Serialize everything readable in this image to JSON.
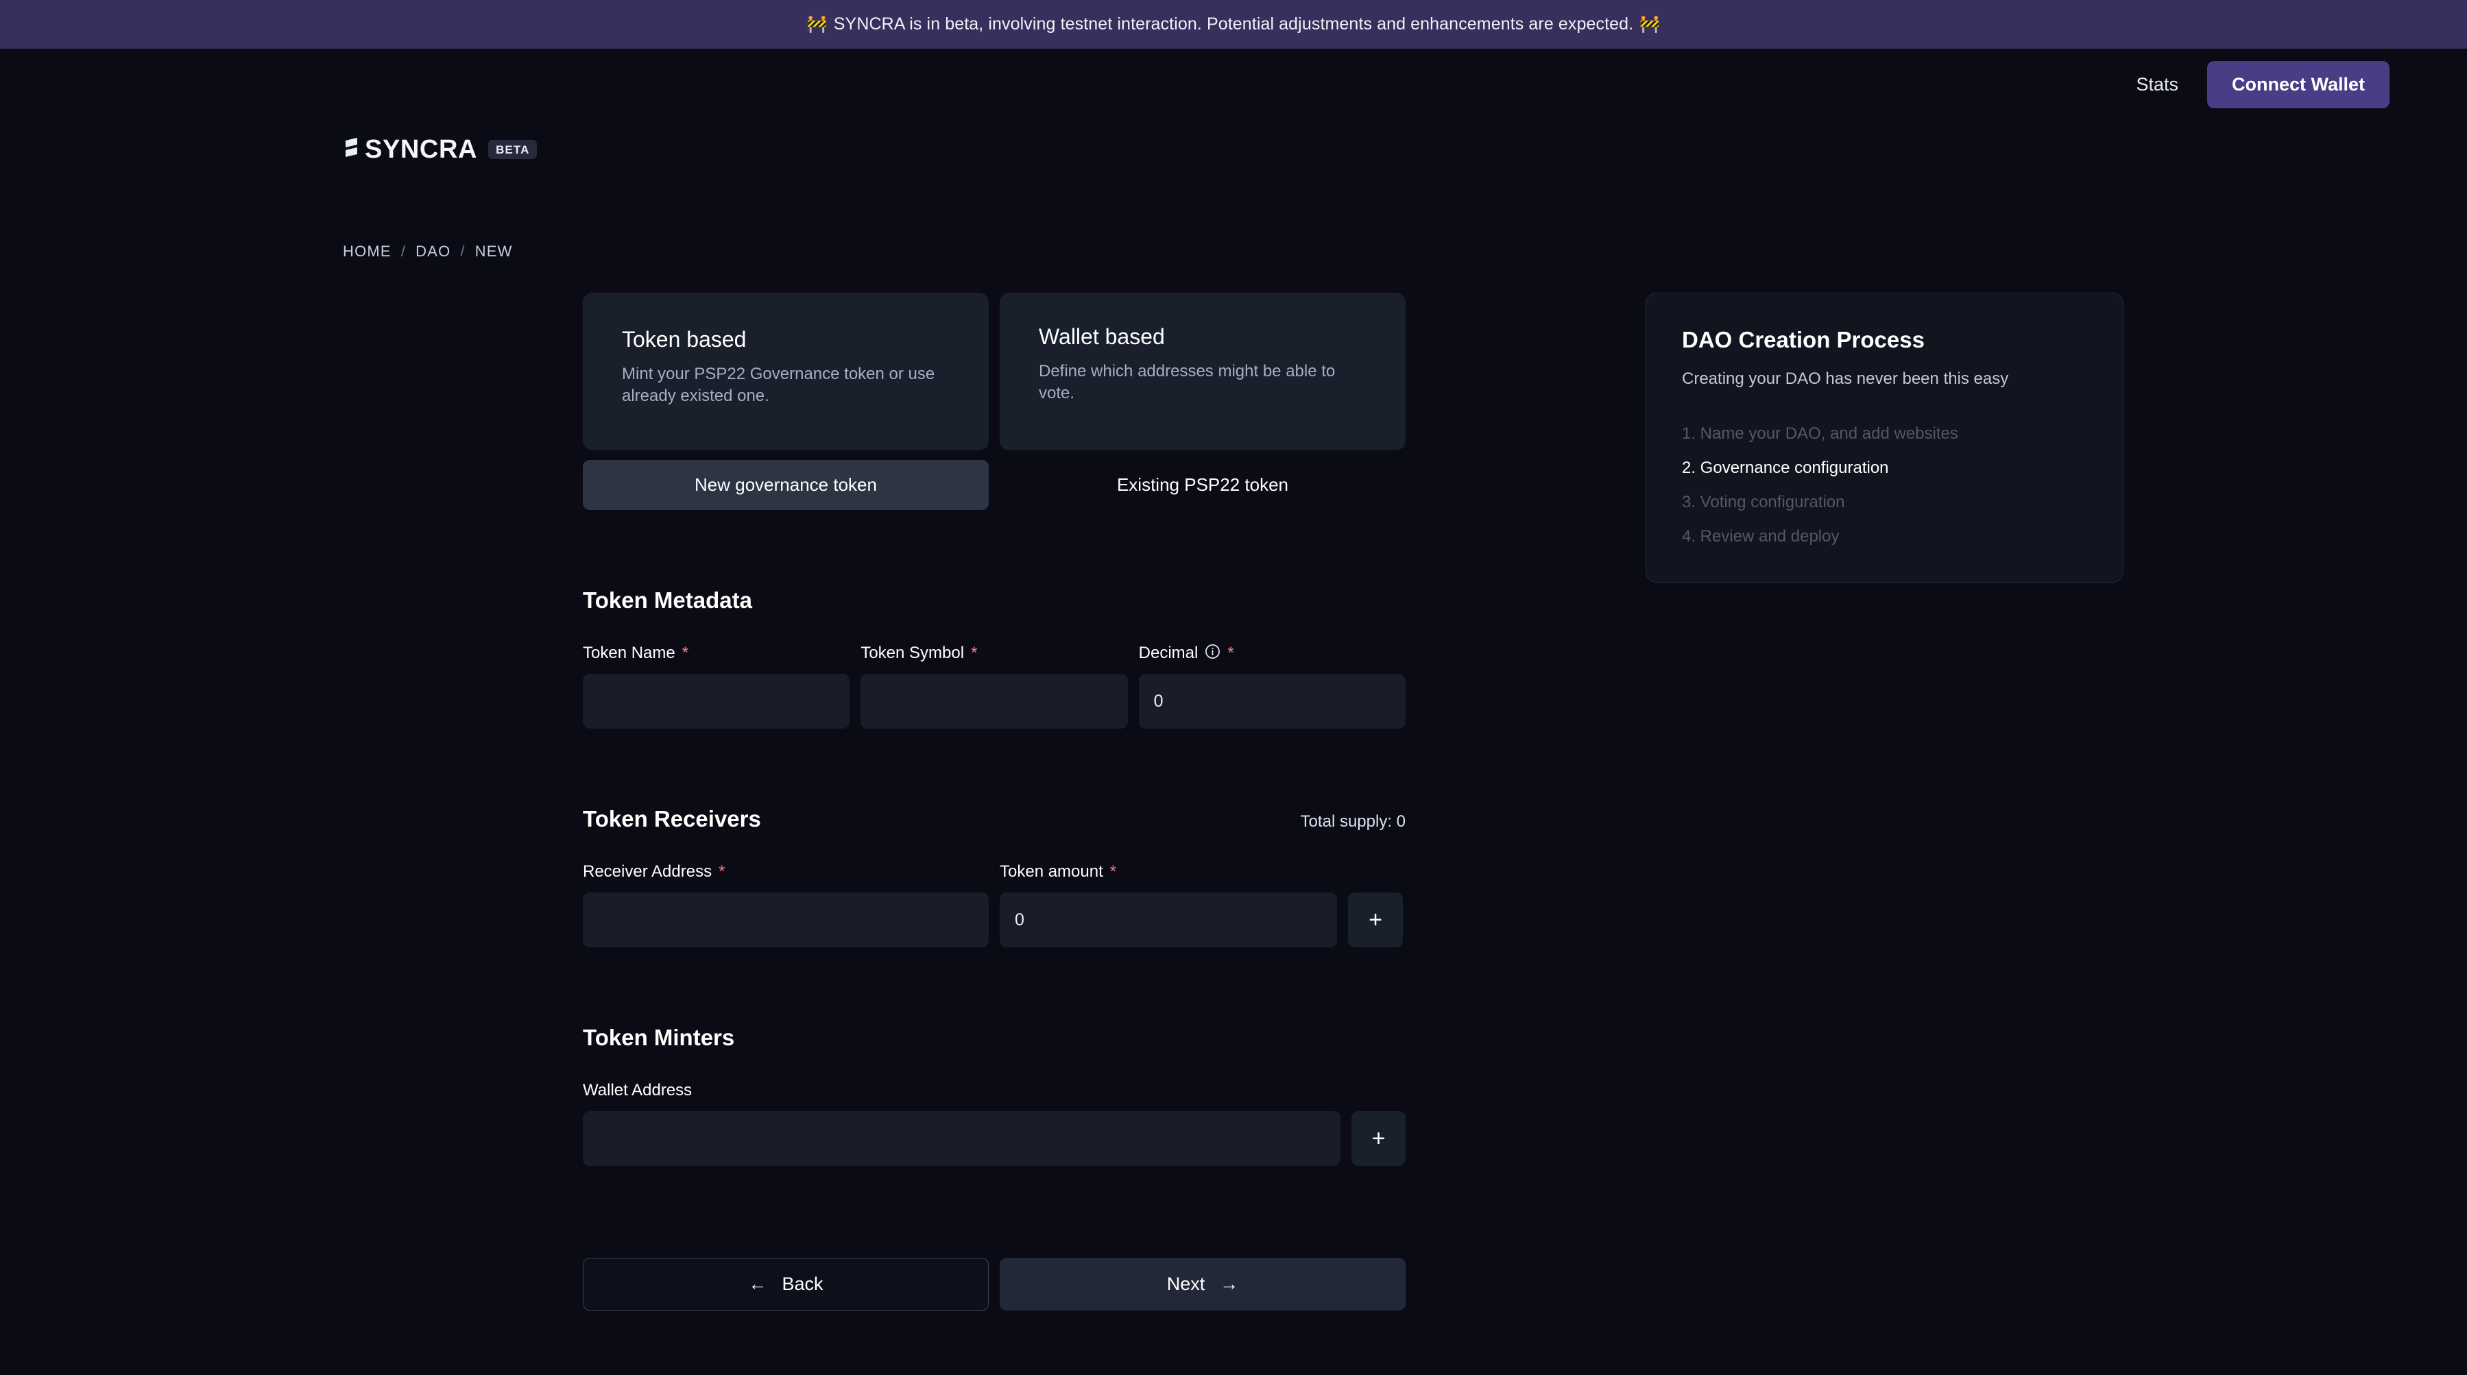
{
  "banner": {
    "emoji_left": "🚧",
    "emoji_right": "🚧",
    "text": "SYNCRA is in beta, involving testnet interaction. Potential adjustments and enhancements are expected."
  },
  "header": {
    "brand_name": "SYNCRA",
    "badge": "BETA",
    "nav_link": "Stats",
    "connect_button": "Connect Wallet",
    "accent_color": "#4b3c86"
  },
  "breadcrumb": {
    "items": [
      "HOME",
      "DAO",
      "NEW"
    ],
    "separator": "/"
  },
  "options": [
    {
      "title": "Token based",
      "description": "Mint your PSP22 Governance token or use already existed one.",
      "tab_label": "New governance token",
      "tab_active": true
    },
    {
      "title": "Wallet based",
      "description": "Define which addresses might be able to vote.",
      "tab_label": "Existing PSP22 token",
      "tab_active": false
    }
  ],
  "token_metadata": {
    "section_title": "Token Metadata",
    "fields": [
      {
        "label": "Token Name",
        "required_mark": "*",
        "value": "",
        "placeholder": ""
      },
      {
        "label": "Token Symbol",
        "required_mark": "*",
        "value": "",
        "placeholder": ""
      },
      {
        "label": "Decimal",
        "required_mark": "*",
        "value": "0",
        "placeholder": "",
        "info_icon": "info-icon"
      }
    ]
  },
  "token_receivers": {
    "section_title": "Token Receivers",
    "total_supply": "Total supply: 0",
    "fields": [
      {
        "label": "Receiver Address",
        "required_mark": "*",
        "value": "",
        "placeholder": ""
      },
      {
        "label": "Token amount",
        "required_mark": "*",
        "value": "0",
        "placeholder": ""
      }
    ],
    "add_button": "+"
  },
  "token_minters": {
    "section_title": "Token Minters",
    "fields": [
      {
        "label": "Wallet Address",
        "required_mark": "",
        "value": "",
        "placeholder": ""
      }
    ],
    "add_button": "+"
  },
  "footer": {
    "back_label": "Back",
    "back_arrow": "←",
    "next_label": "Next",
    "next_arrow": "→"
  },
  "process": {
    "title": "DAO Creation Process",
    "subtitle": "Creating your DAO has never been this easy",
    "steps": [
      {
        "label": "1. Name your DAO, and add websites",
        "active": false
      },
      {
        "label": "2. Governance configuration",
        "active": true
      },
      {
        "label": "3. Voting configuration",
        "active": false
      },
      {
        "label": "4. Review and deploy",
        "active": false
      }
    ]
  }
}
